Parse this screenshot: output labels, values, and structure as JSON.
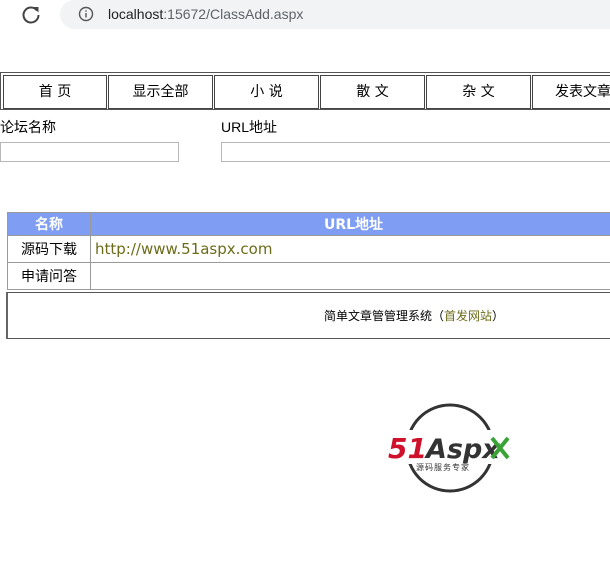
{
  "browser": {
    "url_host": "localhost",
    "url_rest": ":15672/ClassAdd.aspx"
  },
  "nav": {
    "items": [
      {
        "label": "首 页"
      },
      {
        "label": "显示全部"
      },
      {
        "label": "小 说"
      },
      {
        "label": "散 文"
      },
      {
        "label": "杂 文"
      },
      {
        "label": "发表文章"
      }
    ]
  },
  "form": {
    "forum_name_label": "论坛名称",
    "url_label": "URL地址",
    "forum_name_value": "",
    "url_value": ""
  },
  "table": {
    "headers": [
      "名称",
      "URL地址"
    ],
    "rows": [
      {
        "name": "源码下载",
        "url": "http://www.51aspx.com"
      },
      {
        "name": "申请问答",
        "url": ""
      }
    ]
  },
  "footer": {
    "text": "简单文章管管理系统（",
    "link": "首发网站",
    "close": "）"
  },
  "logo": {
    "brand_51": "51",
    "brand_aspx": "Aspx",
    "tagline": "源码服务专家",
    "colors": {
      "red": "#d0112b",
      "green": "#3aa335",
      "dark": "#333333"
    }
  }
}
